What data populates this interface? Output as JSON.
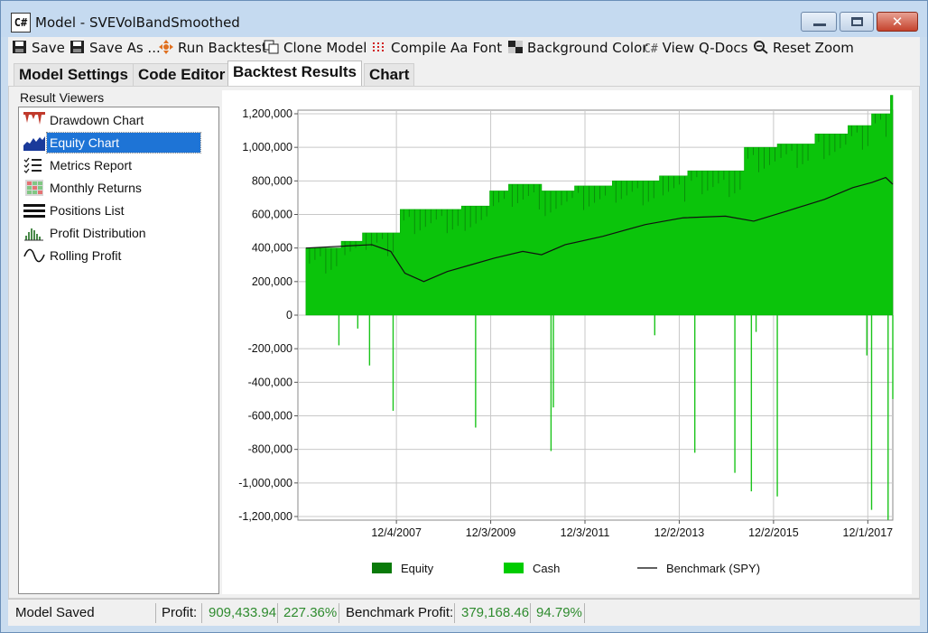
{
  "window": {
    "app_icon": "C#",
    "title": "Model - SVEVolBandSmoothed"
  },
  "toolbar": {
    "save": "Save",
    "save_as": "Save As ...",
    "run_backtest": "Run Backtest",
    "clone_model": "Clone Model",
    "compile": "Compile",
    "font_icon_text": "Aa",
    "font": "Font",
    "background_color": "Background Color",
    "qdocs_icon_text": "C#",
    "view_qdocs": "View Q-Docs",
    "reset_zoom": "Reset Zoom"
  },
  "tabs": [
    "Model Settings",
    "Code Editor",
    "Backtest Results",
    "Chart"
  ],
  "active_tab": "Backtest Results",
  "result_viewers": {
    "label": "Result Viewers",
    "items": [
      {
        "label": "Drawdown Chart",
        "icon": "drawdown-chart-icon"
      },
      {
        "label": "Equity Chart",
        "icon": "equity-chart-icon",
        "selected": true
      },
      {
        "label": "Metrics Report",
        "icon": "metrics-report-icon"
      },
      {
        "label": "Monthly Returns",
        "icon": "monthly-returns-icon"
      },
      {
        "label": "Positions List",
        "icon": "positions-list-icon"
      },
      {
        "label": "Profit Distribution",
        "icon": "profit-distribution-icon"
      },
      {
        "label": "Rolling Profit",
        "icon": "rolling-profit-icon"
      }
    ]
  },
  "chart_data": {
    "type": "area",
    "x_ticks": [
      "12/4/2007",
      "12/3/2009",
      "12/3/2011",
      "12/2/2013",
      "12/2/2015",
      "12/1/2017"
    ],
    "y_ticks": [
      "1,200,000",
      "1,000,000",
      "800,000",
      "600,000",
      "400,000",
      "200,000",
      "0",
      "-200,000",
      "-400,000",
      "-600,000",
      "-800,000",
      "-1,000,000",
      "-1,200,000"
    ],
    "ylim": [
      -1200000,
      1200000
    ],
    "grid": true,
    "legend_position": "bottom",
    "legend": [
      {
        "name": "Equity",
        "color": "#0a7a0a"
      },
      {
        "name": "Cash",
        "color": "#00cc00"
      },
      {
        "name": "Benchmark (SPY)",
        "color": "#000000"
      }
    ],
    "equity_steps": [
      {
        "year": 2006.0,
        "value": 400000
      },
      {
        "year": 2006.75,
        "value": 440000
      },
      {
        "year": 2007.2,
        "value": 490000
      },
      {
        "year": 2008.0,
        "value": 630000
      },
      {
        "year": 2009.3,
        "value": 650000
      },
      {
        "year": 2009.9,
        "value": 740000
      },
      {
        "year": 2010.3,
        "value": 780000
      },
      {
        "year": 2011.0,
        "value": 740000
      },
      {
        "year": 2011.7,
        "value": 770000
      },
      {
        "year": 2012.5,
        "value": 800000
      },
      {
        "year": 2013.5,
        "value": 830000
      },
      {
        "year": 2014.1,
        "value": 860000
      },
      {
        "year": 2015.3,
        "value": 1000000
      },
      {
        "year": 2016.0,
        "value": 1020000
      },
      {
        "year": 2016.8,
        "value": 1080000
      },
      {
        "year": 2017.5,
        "value": 1130000
      },
      {
        "year": 2018.0,
        "value": 1200000
      },
      {
        "year": 2018.4,
        "value": 1310000
      }
    ],
    "cash_spikes": [
      {
        "year": 2006.7,
        "value": -180000
      },
      {
        "year": 2007.1,
        "value": -80000
      },
      {
        "year": 2007.35,
        "value": -300000
      },
      {
        "year": 2007.85,
        "value": -570000
      },
      {
        "year": 2009.6,
        "value": -670000
      },
      {
        "year": 2011.2,
        "value": -810000
      },
      {
        "year": 2011.25,
        "value": -550000
      },
      {
        "year": 2013.4,
        "value": -120000
      },
      {
        "year": 2014.25,
        "value": -820000
      },
      {
        "year": 2015.1,
        "value": -940000
      },
      {
        "year": 2015.45,
        "value": -1050000
      },
      {
        "year": 2015.55,
        "value": -100000
      },
      {
        "year": 2016.0,
        "value": -1080000
      },
      {
        "year": 2017.9,
        "value": -240000
      },
      {
        "year": 2018.0,
        "value": -1160000
      },
      {
        "year": 2018.35,
        "value": -1220000
      },
      {
        "year": 2018.45,
        "value": -500000
      }
    ],
    "benchmark": [
      {
        "year": 2006.0,
        "value": 400000
      },
      {
        "year": 2007.4,
        "value": 420000
      },
      {
        "year": 2007.8,
        "value": 380000
      },
      {
        "year": 2008.1,
        "value": 250000
      },
      {
        "year": 2008.5,
        "value": 200000
      },
      {
        "year": 2009.0,
        "value": 260000
      },
      {
        "year": 2009.5,
        "value": 300000
      },
      {
        "year": 2010.0,
        "value": 340000
      },
      {
        "year": 2010.6,
        "value": 380000
      },
      {
        "year": 2011.0,
        "value": 360000
      },
      {
        "year": 2011.5,
        "value": 420000
      },
      {
        "year": 2012.3,
        "value": 470000
      },
      {
        "year": 2013.2,
        "value": 540000
      },
      {
        "year": 2014.0,
        "value": 580000
      },
      {
        "year": 2014.9,
        "value": 590000
      },
      {
        "year": 2015.5,
        "value": 560000
      },
      {
        "year": 2016.2,
        "value": 620000
      },
      {
        "year": 2017.0,
        "value": 690000
      },
      {
        "year": 2017.6,
        "value": 760000
      },
      {
        "year": 2018.0,
        "value": 790000
      },
      {
        "year": 2018.3,
        "value": 820000
      },
      {
        "year": 2018.45,
        "value": 780000
      }
    ]
  },
  "status": {
    "message": "Model Saved",
    "profit_label": "Profit:",
    "profit_value": "909,433.94",
    "profit_pct": "227.36%",
    "benchmark_label": "Benchmark Profit:",
    "benchmark_value": "379,168.46",
    "benchmark_pct": "94.79%"
  }
}
